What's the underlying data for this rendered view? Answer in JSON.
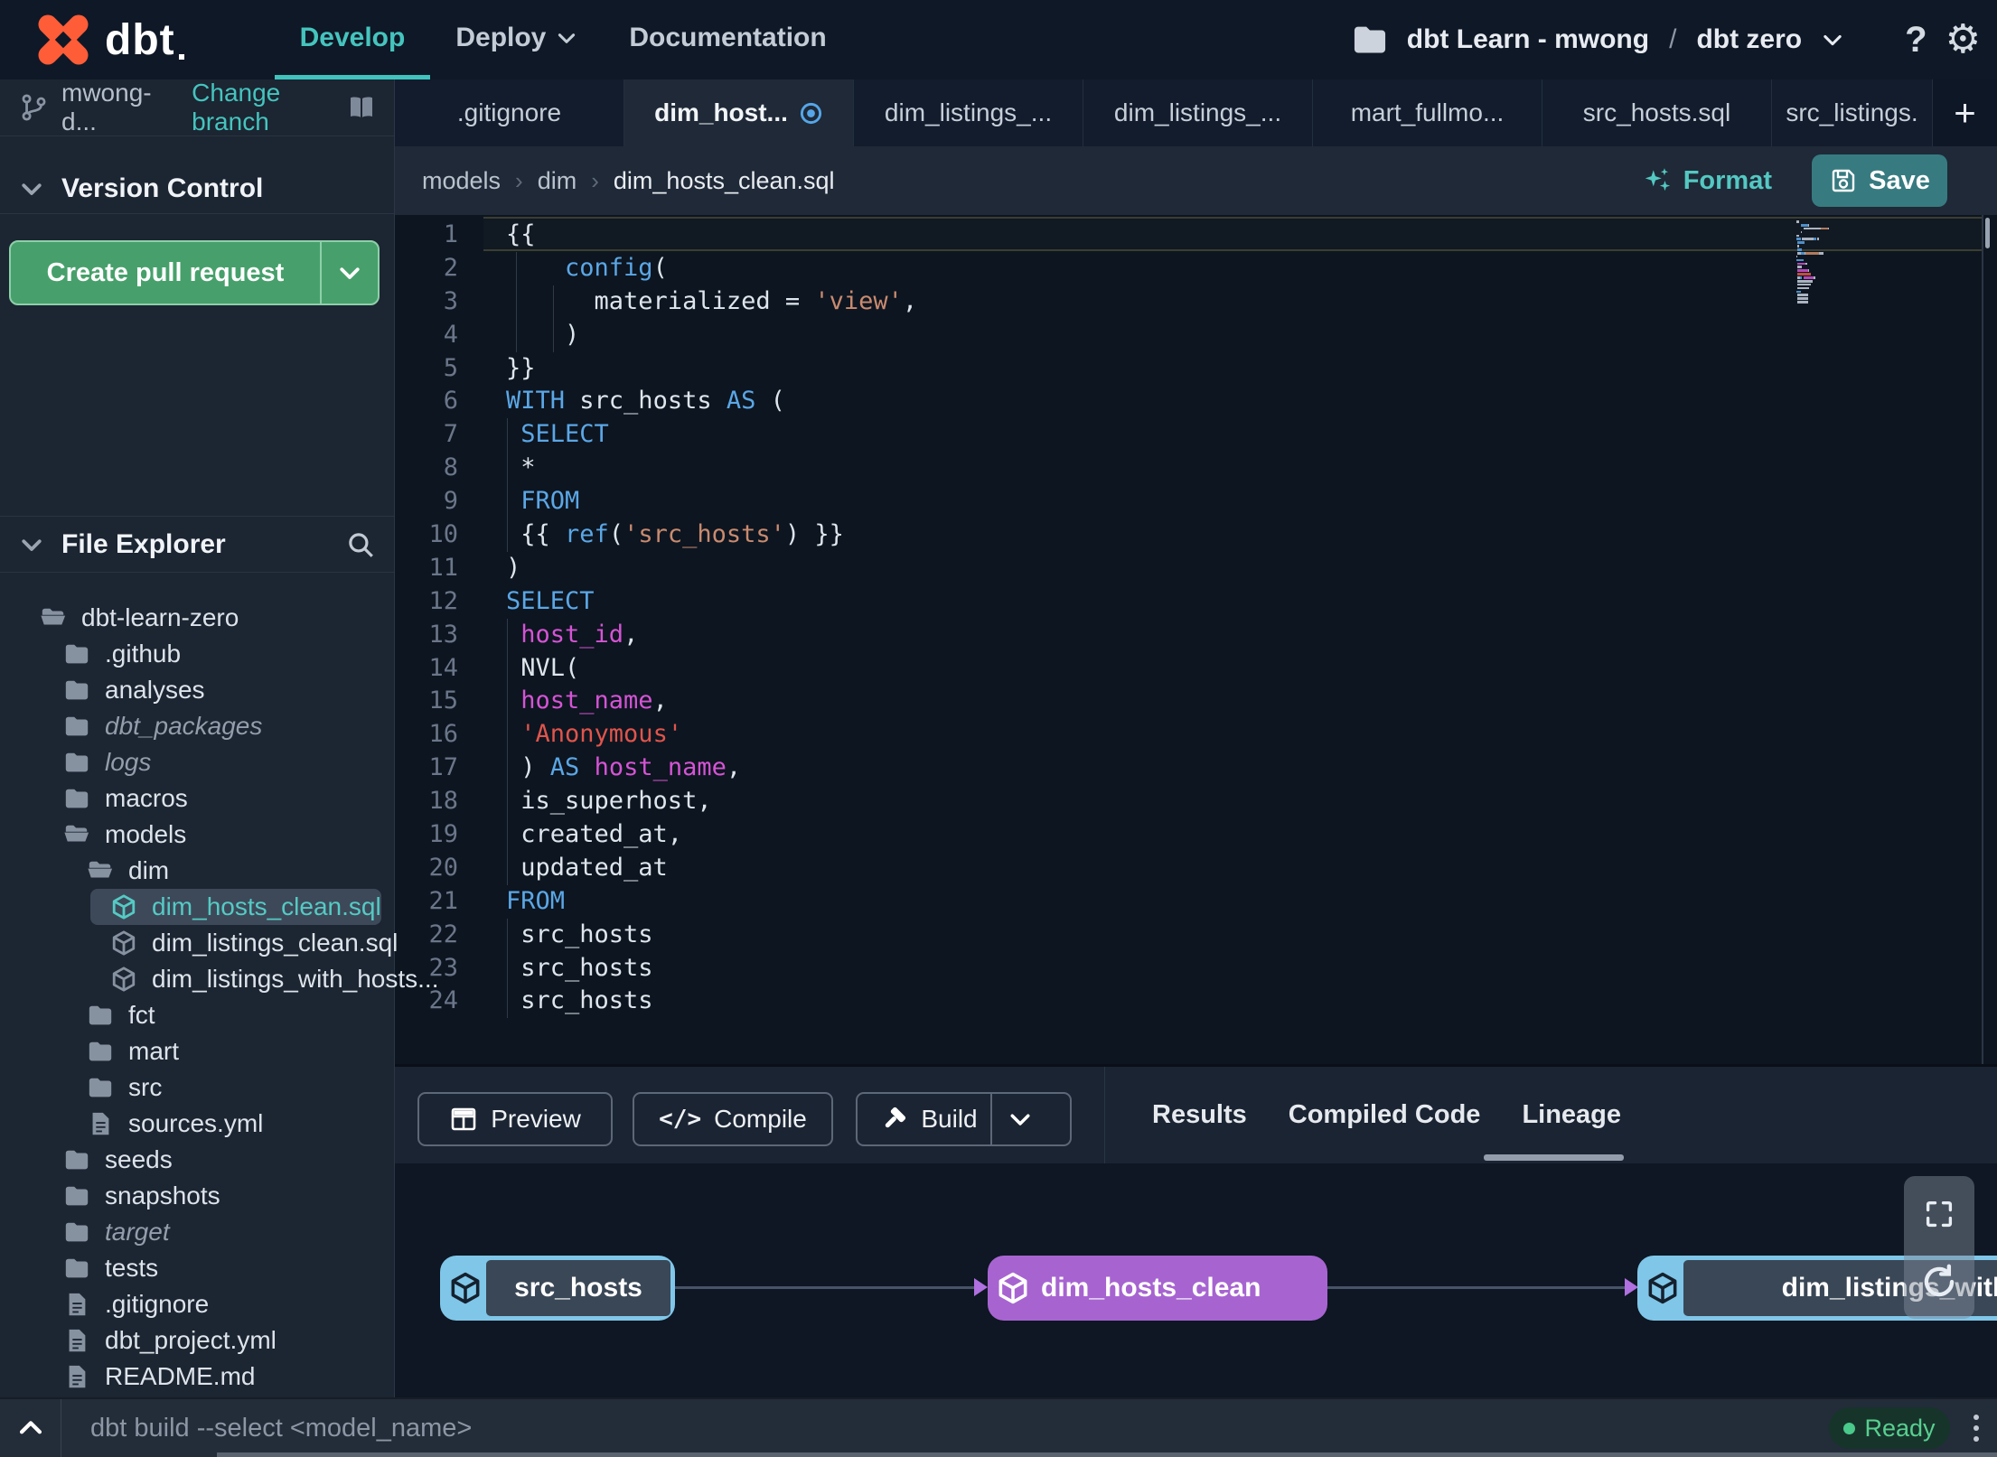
{
  "topnav": {
    "logo_text": "dbt",
    "nav_items": [
      {
        "label": "Develop",
        "active": true
      },
      {
        "label": "Deploy",
        "chevron": true
      },
      {
        "label": "Documentation"
      }
    ],
    "project_selector": {
      "account": "dbt Learn - mwong",
      "separator": "/",
      "project": "dbt zero"
    },
    "help_glyph": "?",
    "settings_glyph": "⚙"
  },
  "sidebar": {
    "branch": {
      "name": "mwong-d...",
      "change_label": "Change branch"
    },
    "version_control": {
      "title": "Version Control",
      "create_pr_label": "Create pull request"
    },
    "file_explorer": {
      "title": "File Explorer",
      "tree": [
        {
          "label": "dbt-learn-zero",
          "type": "folder-open",
          "indent": 0
        },
        {
          "label": ".github",
          "type": "folder",
          "indent": 1
        },
        {
          "label": "analyses",
          "type": "folder",
          "indent": 1
        },
        {
          "label": "dbt_packages",
          "type": "folder",
          "indent": 1,
          "italic": true
        },
        {
          "label": "logs",
          "type": "folder",
          "indent": 1,
          "italic": true
        },
        {
          "label": "macros",
          "type": "folder",
          "indent": 1
        },
        {
          "label": "models",
          "type": "folder-open",
          "indent": 1
        },
        {
          "label": "dim",
          "type": "folder-open",
          "indent": 2
        },
        {
          "label": "dim_hosts_clean.sql",
          "type": "model",
          "indent": 3,
          "selected": true,
          "modified": true
        },
        {
          "label": "dim_listings_clean.sql",
          "type": "model",
          "indent": 3
        },
        {
          "label": "dim_listings_with_hosts...",
          "type": "model",
          "indent": 3
        },
        {
          "label": "fct",
          "type": "folder",
          "indent": 2
        },
        {
          "label": "mart",
          "type": "folder",
          "indent": 2
        },
        {
          "label": "src",
          "type": "folder",
          "indent": 2
        },
        {
          "label": "sources.yml",
          "type": "file",
          "indent": 2
        },
        {
          "label": "seeds",
          "type": "folder",
          "indent": 1
        },
        {
          "label": "snapshots",
          "type": "folder",
          "indent": 1
        },
        {
          "label": "target",
          "type": "folder",
          "indent": 1,
          "italic": true
        },
        {
          "label": "tests",
          "type": "folder",
          "indent": 1
        },
        {
          "label": ".gitignore",
          "type": "file",
          "indent": 1
        },
        {
          "label": "dbt_project.yml",
          "type": "file",
          "indent": 1
        },
        {
          "label": "README.md",
          "type": "file",
          "indent": 1
        }
      ]
    }
  },
  "editor": {
    "tabs": [
      {
        "label": ".gitignore"
      },
      {
        "label": "dim_host...",
        "active": true,
        "modified": true
      },
      {
        "label": "dim_listings_..."
      },
      {
        "label": "dim_listings_..."
      },
      {
        "label": "mart_fullmo..."
      },
      {
        "label": "src_hosts.sql"
      },
      {
        "label": "src_listings."
      }
    ],
    "new_tab_glyph": "+",
    "breadcrumb": [
      "models",
      "dim",
      "dim_hosts_clean.sql"
    ],
    "breadcrumb_separator": "›",
    "format_label": "Format",
    "save_label": "Save",
    "code_lines": [
      [
        {
          "t": "{{",
          "c": "fg"
        }
      ],
      [
        {
          "t": "    ",
          "c": "fg"
        },
        {
          "t": "config",
          "c": "kw"
        },
        {
          "t": "(",
          "c": "fg"
        }
      ],
      [
        {
          "t": "      materialized = ",
          "c": "fg"
        },
        {
          "t": "'view'",
          "c": "str"
        },
        {
          "t": ",",
          "c": "fg"
        }
      ],
      [
        {
          "t": "    )",
          "c": "fg"
        }
      ],
      [
        {
          "t": "}}",
          "c": "fg"
        }
      ],
      [
        {
          "t": "WITH",
          "c": "kw"
        },
        {
          "t": " src_hosts ",
          "c": "fg"
        },
        {
          "t": "AS",
          "c": "kw"
        },
        {
          "t": " (",
          "c": "fg"
        }
      ],
      [
        {
          "t": " ",
          "c": "fg"
        },
        {
          "t": "SELECT",
          "c": "kw"
        }
      ],
      [
        {
          "t": " *",
          "c": "fg"
        }
      ],
      [
        {
          "t": " ",
          "c": "fg"
        },
        {
          "t": "FROM",
          "c": "kw"
        }
      ],
      [
        {
          "t": " {{ ",
          "c": "fg"
        },
        {
          "t": "ref",
          "c": "kw"
        },
        {
          "t": "(",
          "c": "fg"
        },
        {
          "t": "'src_hosts'",
          "c": "str"
        },
        {
          "t": ") }}",
          "c": "fg"
        }
      ],
      [
        {
          "t": ")",
          "c": "fg"
        }
      ],
      [
        {
          "t": "SELECT",
          "c": "kw"
        }
      ],
      [
        {
          "t": " ",
          "c": "fg"
        },
        {
          "t": "host_id",
          "c": "id"
        },
        {
          "t": ",",
          "c": "fg"
        }
      ],
      [
        {
          "t": " NVL(",
          "c": "fg"
        }
      ],
      [
        {
          "t": " ",
          "c": "fg"
        },
        {
          "t": "host_name",
          "c": "id"
        },
        {
          "t": ",",
          "c": "fg"
        }
      ],
      [
        {
          "t": " ",
          "c": "fg"
        },
        {
          "t": "'Anonymous'",
          "c": "str2"
        }
      ],
      [
        {
          "t": " ) ",
          "c": "fg"
        },
        {
          "t": "AS",
          "c": "kw"
        },
        {
          "t": " ",
          "c": "fg"
        },
        {
          "t": "host_name",
          "c": "id"
        },
        {
          "t": ",",
          "c": "fg"
        }
      ],
      [
        {
          "t": " is_superhost,",
          "c": "fg"
        }
      ],
      [
        {
          "t": " created_at,",
          "c": "fg"
        }
      ],
      [
        {
          "t": " updated_at",
          "c": "fg"
        }
      ],
      [
        {
          "t": "FROM",
          "c": "kw"
        }
      ],
      [
        {
          "t": " src_hosts",
          "c": "fg"
        }
      ],
      [
        {
          "t": " src_hosts",
          "c": "fg"
        }
      ],
      [
        {
          "t": " src_hosts",
          "c": "fg"
        }
      ]
    ]
  },
  "bottom_panel": {
    "action_buttons": [
      {
        "label": "Preview",
        "icon": "table-icon"
      },
      {
        "label": "Compile",
        "icon": "code-icon"
      },
      {
        "label": "Build",
        "icon": "hammer-icon",
        "split": true
      }
    ],
    "compile_glyph": "</>",
    "tabs": [
      {
        "label": "Results"
      },
      {
        "label": "Compiled Code"
      },
      {
        "label": "Lineage",
        "active": true
      }
    ],
    "lineage_nodes": [
      {
        "name": "src_hosts",
        "variant": "blue"
      },
      {
        "name": "dim_hosts_clean",
        "variant": "purple"
      },
      {
        "name": "dim_listings_with_h",
        "variant": "blue"
      }
    ]
  },
  "command_bar": {
    "command": "dbt build --select <model_name>",
    "status": "Ready"
  },
  "colors": {
    "accent_teal": "#45c4be",
    "save_teal": "#377b80",
    "pr_green": "#47a06b",
    "status_green": "#58cf90",
    "node_blue": "#7fc6e8",
    "node_purple": "#a764d0",
    "modified_blue": "#55a6e8",
    "keyword_blue": "#5ba7e6",
    "string_orange": "#c98b6f",
    "string_red": "#e0554c",
    "identifier_magenta": "#d554d5"
  }
}
